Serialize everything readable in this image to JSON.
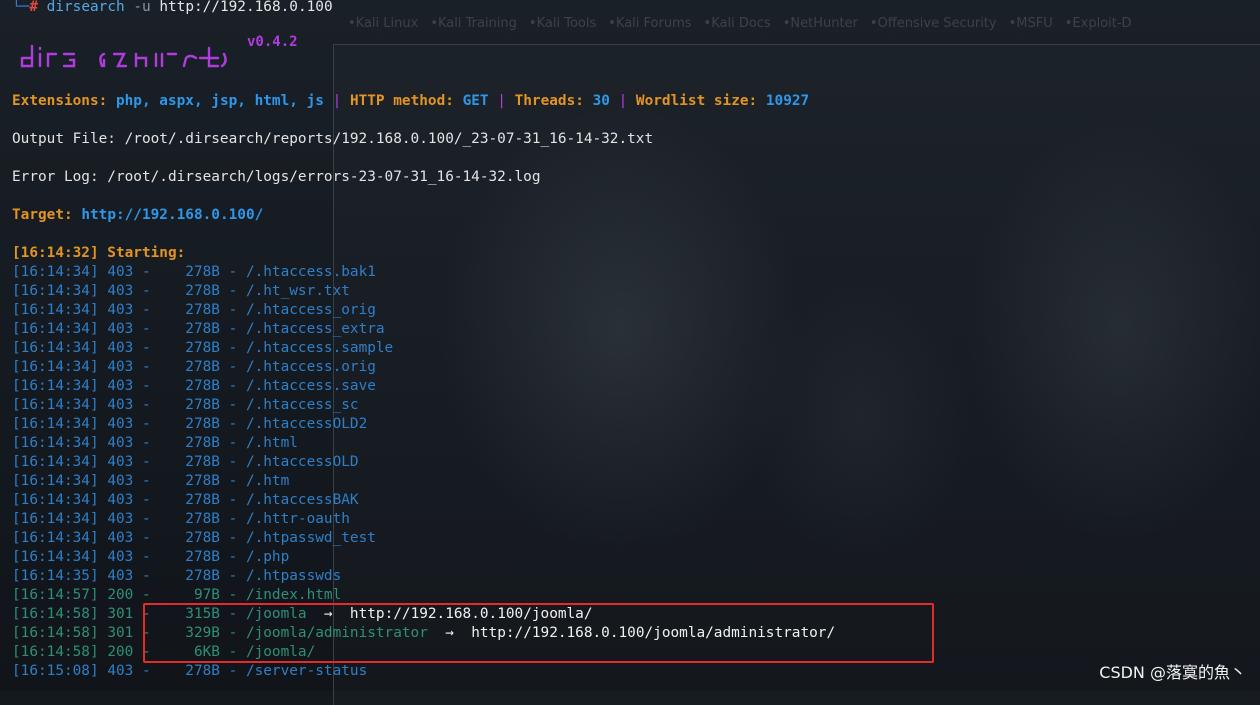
{
  "command": {
    "arrow": "└─",
    "hash": "#",
    "program": "dirsearch",
    "flag": "-u",
    "target": "http://192.168.0.100"
  },
  "banner": {
    "version": "v0.4.2"
  },
  "ghost_tabs": [
    "Kali Linux",
    "Kali Training",
    "Kali Tools",
    "Kali Forums",
    "Kali Docs",
    "NetHunter",
    "Offensive Security",
    "MSFU",
    "Exploit-D"
  ],
  "config": {
    "extensions_label": "Extensions:",
    "extensions_value": "php, aspx, jsp, html, js",
    "separator": "|",
    "method_label": "HTTP method:",
    "method_value": "GET",
    "threads_label": "Threads:",
    "threads_value": "30",
    "wordlist_label": "Wordlist size:",
    "wordlist_value": "10927"
  },
  "output_file": "Output File: /root/.dirsearch/reports/192.168.0.100/_23-07-31_16-14-32.txt",
  "error_log": "Error Log: /root/.dirsearch/logs/errors-23-07-31_16-14-32.log",
  "target": {
    "label": "Target:",
    "value": "http://192.168.0.100/"
  },
  "starting": "[16:14:32] Starting:",
  "results": [
    {
      "time": "[16:14:34]",
      "code": "403",
      "size": "278B",
      "path": "/.htaccess.bak1",
      "redirect": ""
    },
    {
      "time": "[16:14:34]",
      "code": "403",
      "size": "278B",
      "path": "/.ht_wsr.txt",
      "redirect": ""
    },
    {
      "time": "[16:14:34]",
      "code": "403",
      "size": "278B",
      "path": "/.htaccess_orig",
      "redirect": ""
    },
    {
      "time": "[16:14:34]",
      "code": "403",
      "size": "278B",
      "path": "/.htaccess_extra",
      "redirect": ""
    },
    {
      "time": "[16:14:34]",
      "code": "403",
      "size": "278B",
      "path": "/.htaccess.sample",
      "redirect": ""
    },
    {
      "time": "[16:14:34]",
      "code": "403",
      "size": "278B",
      "path": "/.htaccess.orig",
      "redirect": ""
    },
    {
      "time": "[16:14:34]",
      "code": "403",
      "size": "278B",
      "path": "/.htaccess.save",
      "redirect": ""
    },
    {
      "time": "[16:14:34]",
      "code": "403",
      "size": "278B",
      "path": "/.htaccess_sc",
      "redirect": ""
    },
    {
      "time": "[16:14:34]",
      "code": "403",
      "size": "278B",
      "path": "/.htaccessOLD2",
      "redirect": ""
    },
    {
      "time": "[16:14:34]",
      "code": "403",
      "size": "278B",
      "path": "/.html",
      "redirect": ""
    },
    {
      "time": "[16:14:34]",
      "code": "403",
      "size": "278B",
      "path": "/.htaccessOLD",
      "redirect": ""
    },
    {
      "time": "[16:14:34]",
      "code": "403",
      "size": "278B",
      "path": "/.htm",
      "redirect": ""
    },
    {
      "time": "[16:14:34]",
      "code": "403",
      "size": "278B",
      "path": "/.htaccessBAK",
      "redirect": ""
    },
    {
      "time": "[16:14:34]",
      "code": "403",
      "size": "278B",
      "path": "/.httr-oauth",
      "redirect": ""
    },
    {
      "time": "[16:14:34]",
      "code": "403",
      "size": "278B",
      "path": "/.htpasswd_test",
      "redirect": ""
    },
    {
      "time": "[16:14:34]",
      "code": "403",
      "size": "278B",
      "path": "/.php",
      "redirect": ""
    },
    {
      "time": "[16:14:35]",
      "code": "403",
      "size": "278B",
      "path": "/.htpasswds",
      "redirect": ""
    },
    {
      "time": "[16:14:57]",
      "code": "200",
      "size": "97B",
      "path": "/index.html",
      "redirect": ""
    },
    {
      "time": "[16:14:58]",
      "code": "301",
      "size": "315B",
      "path": "/joomla",
      "redirect": "http://192.168.0.100/joomla/"
    },
    {
      "time": "[16:14:58]",
      "code": "301",
      "size": "329B",
      "path": "/joomla/administrator",
      "redirect": "http://192.168.0.100/joomla/administrator/"
    },
    {
      "time": "[16:14:58]",
      "code": "200",
      "size": "6KB",
      "path": "/joomla/",
      "redirect": ""
    },
    {
      "time": "[16:15:08]",
      "code": "403",
      "size": "278B",
      "path": "/server-status",
      "redirect": ""
    }
  ],
  "arrow_symbol": "→",
  "watermark": "CSDN @落寞的魚丶",
  "colors": {
    "orange": "#e39423",
    "blue": "#2f97ea",
    "purple": "#b03ce0",
    "teal": "#2f8f76",
    "highlight": "#e32b2b"
  }
}
